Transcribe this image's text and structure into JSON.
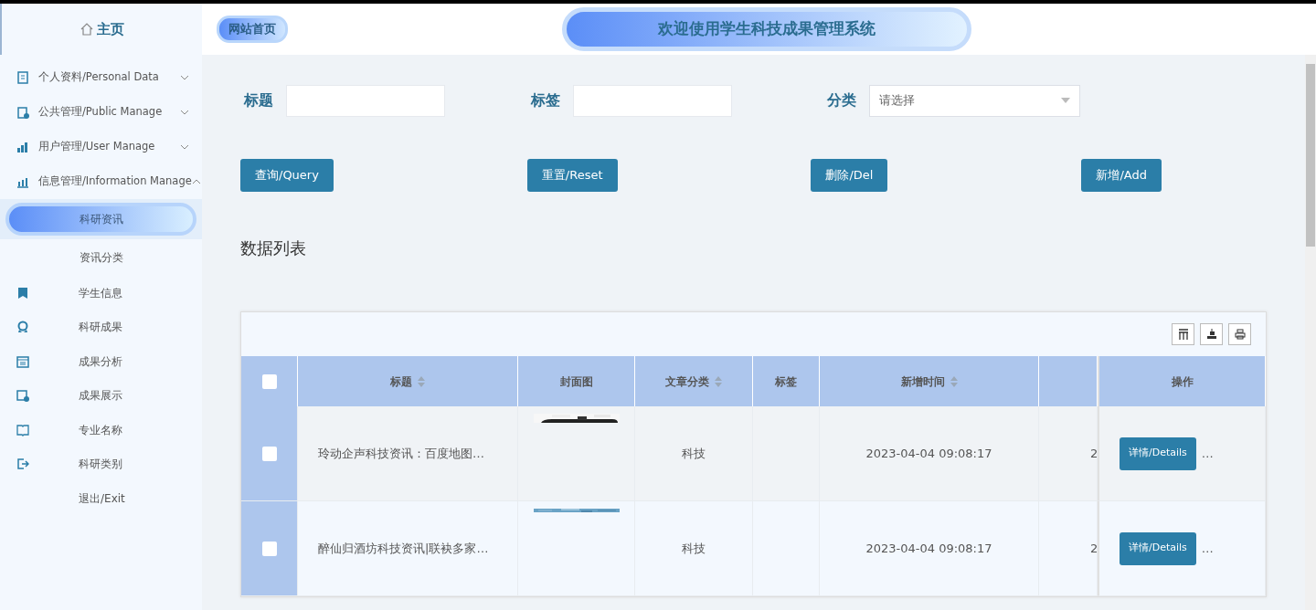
{
  "sidebar": {
    "home": "主页",
    "items": [
      {
        "kind": "group",
        "label": "个人资料/Personal Data",
        "expanded": false
      },
      {
        "kind": "group",
        "label": "公共管理/Public Manage",
        "expanded": false
      },
      {
        "kind": "group",
        "label": "用户管理/User Manage",
        "expanded": false
      },
      {
        "kind": "group",
        "label": "信息管理/Information Manage",
        "expanded": true,
        "children": [
          {
            "label": "科研资讯",
            "selected": true
          },
          {
            "label": "资讯分类",
            "selected": false
          }
        ]
      },
      {
        "kind": "link",
        "label": "学生信息"
      },
      {
        "kind": "link",
        "label": "科研成果"
      },
      {
        "kind": "link",
        "label": "成果分析"
      },
      {
        "kind": "link",
        "label": "成果展示"
      },
      {
        "kind": "link",
        "label": "专业名称"
      },
      {
        "kind": "link",
        "label": "科研类别"
      },
      {
        "kind": "exit",
        "label": "退出/Exit"
      }
    ]
  },
  "header": {
    "home_link": "网站首页",
    "title": "欢迎使用学生科技成果管理系统"
  },
  "filters": [
    {
      "kind": "text",
      "label": "标题"
    },
    {
      "kind": "text",
      "label": "标签"
    },
    {
      "kind": "select",
      "label": "分类",
      "placeholder": "请选择"
    }
  ],
  "buttons": [
    "查询/Query",
    "重置/Reset",
    "删除/Del",
    "新增/Add"
  ],
  "section_title": "数据列表",
  "table": {
    "select_all": {
      "checked": false
    },
    "columns": [
      {
        "label": "标题",
        "sortable": true
      },
      {
        "label": "封面图",
        "sortable": false
      },
      {
        "label": "文章分类",
        "sortable": true
      },
      {
        "label": "标签",
        "sortable": false
      },
      {
        "label": "新增时间",
        "sortable": true
      },
      {
        "sortable": false
      },
      {
        "label": "操作",
        "sortable": false
      }
    ],
    "rows": [
      {
        "checked": false,
        "title": "玲动企声科技资讯：百度地图…",
        "category": "科技",
        "time": "2023-04-04 09:08:17",
        "column_7": "2",
        "action": "详情/Details",
        "more": "…"
      },
      {
        "checked": false,
        "title": "醉仙归酒坊科技资讯|联袂多家…",
        "category": "科技",
        "time": "2023-04-04 09:08:17",
        "column_7": "2",
        "action": "详情/Details",
        "more": "…"
      }
    ]
  }
}
